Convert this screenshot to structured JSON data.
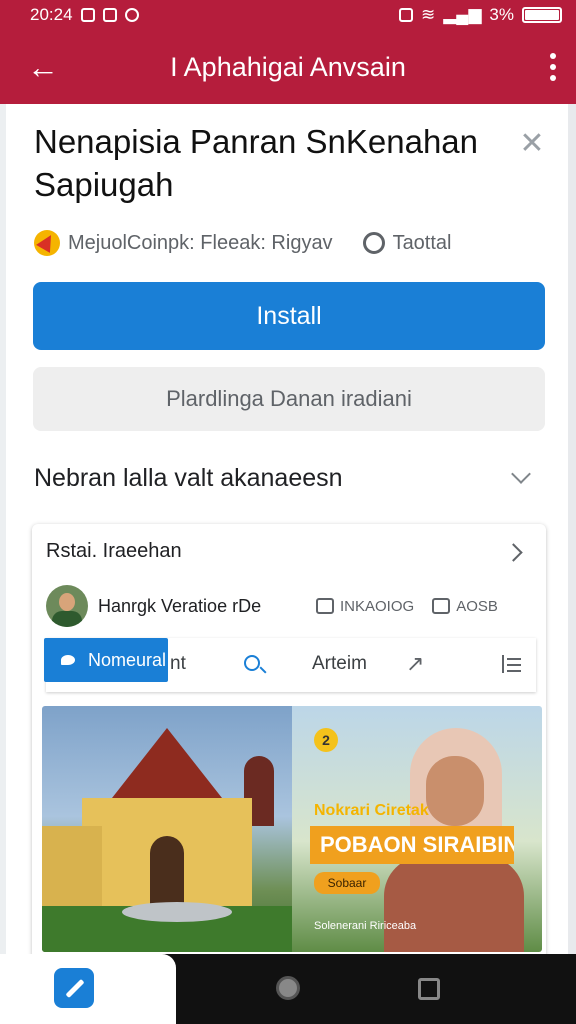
{
  "status_bar": {
    "time": "20:24",
    "battery": "3%"
  },
  "app_bar": {
    "title": "I Aphahigai Anvsain"
  },
  "sheet": {
    "title": "Nenapisia Panran SnKenahan Sapiugah",
    "developer": "MejuolCoinpk: Fleeak: Rigyav",
    "rating_label": "Taottal",
    "install_label": "Install",
    "secondary_label": "Plardlinga Danan iradiani",
    "section_label": "Nebran lalla valt akanaeesn"
  },
  "card": {
    "header": "Rstai. Iraeehan",
    "post_name": "Hanrgk Veratioe rDe",
    "stat1": "INKAOIOG",
    "stat2": "AOSB",
    "toolbar": {
      "pill_label": "Nomeural",
      "pill_suffix": "nt",
      "item_label": "Arteim"
    },
    "banner": {
      "badge": "2",
      "promo_small": "Nokrari Ciretak",
      "promo_big": "POBAON SIRAIBIN",
      "promo_tag": "Sobaar",
      "promo_foot": "Solenerani Ririceaba"
    }
  },
  "colors": {
    "brand": "#b51d3c",
    "accent": "#1a7fd6",
    "promo": "#f0a01e"
  },
  "icons": {
    "back": "arrow-left",
    "menu": "more-vert",
    "close": "close",
    "chevron": "chevron-down",
    "search": "search",
    "share": "share"
  }
}
